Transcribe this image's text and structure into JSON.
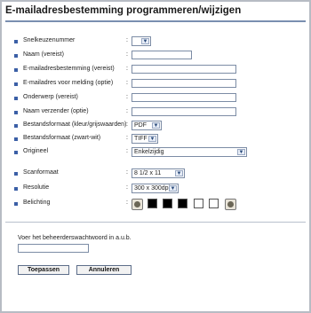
{
  "title": "E-mailadresbestemming programmeren/wijzigen",
  "fields": [
    {
      "label": "Snelkeuzenummer",
      "colon": ":",
      "type": "select",
      "value": ""
    },
    {
      "label": "Naam (vereist)",
      "colon": ":",
      "type": "text",
      "value": ""
    },
    {
      "label": "E-mailadresbestemming (vereist)",
      "colon": ":",
      "type": "text",
      "value": ""
    },
    {
      "label": "E-mailadres voor melding (optie)",
      "colon": ":",
      "type": "text",
      "value": ""
    },
    {
      "label": "Onderwerp (vereist)",
      "colon": ":",
      "type": "text",
      "value": ""
    },
    {
      "label": "Naam verzender (optie)",
      "colon": ":",
      "type": "text",
      "value": ""
    },
    {
      "label": "Bestandsformaat (kleur/grijswaarden)",
      "colon": ":",
      "type": "select",
      "value": "PDF"
    },
    {
      "label": "Bestandsformaat (zwart-wit)",
      "colon": ":",
      "type": "select",
      "value": "TIFF"
    },
    {
      "label": "Origineel",
      "colon": ":",
      "type": "select",
      "value": "Enkelzijdig"
    },
    {
      "label": "Scanformaat",
      "colon": ":",
      "type": "select",
      "value": "8 1/2 x 11"
    },
    {
      "label": "Resolutie",
      "colon": ":",
      "type": "select",
      "value": "300 x 300dpi"
    },
    {
      "label": "Belichting",
      "colon": ":",
      "type": "exposure",
      "value": ""
    }
  ],
  "password_prompt": "Voer het beheerderswachtwoord in a.u.b.",
  "buttons": {
    "submit": "Toepassen",
    "cancel": "Annuleren"
  },
  "colors": {
    "accent": "#3b5fa6",
    "border": "#7c8ca5"
  }
}
